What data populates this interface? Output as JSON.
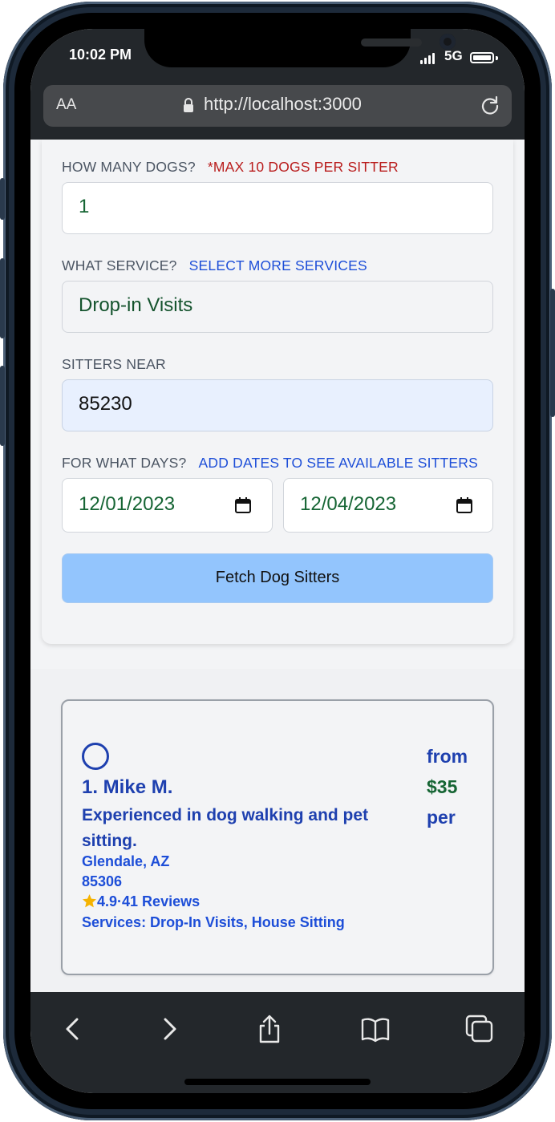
{
  "status_bar": {
    "time": "10:02 PM",
    "network": "5G"
  },
  "browser": {
    "text_size_label": "AA",
    "url": "http://localhost:3000"
  },
  "form": {
    "dogs_label": "HOW MANY DOGS?",
    "dogs_note": "*MAX 10 DOGS PER SITTER",
    "dogs_value": "1",
    "service_label": "WHAT SERVICE?",
    "service_link": "SELECT MORE SERVICES",
    "service_value": "Drop-in Visits",
    "near_label": "SITTERS NEAR",
    "near_value": "85230",
    "days_label": "FOR WHAT DAYS?",
    "days_link": "ADD DATES TO SEE AVAILABLE SITTERS",
    "start_date": "12/01/2023",
    "end_date": "12/04/2023",
    "fetch_button": "Fetch Dog Sitters"
  },
  "results": [
    {
      "name": "1. Mike M.",
      "description": "Experienced in dog walking and pet sitting.",
      "city": "Glendale, AZ",
      "zip": "85306",
      "rating": "4.9",
      "separator": "·",
      "reviews": "41 Reviews",
      "services": "Services: Drop-In Visits, House Sitting",
      "price_from": "from",
      "price": "$35",
      "price_per": "per"
    }
  ],
  "colors": {
    "accent_blue": "#1e40af",
    "link_blue": "#1d4ed8",
    "warning_red": "#b91c1c",
    "value_green": "#166534",
    "button_blue": "#93c5fd",
    "star": "#f5b301"
  },
  "icons": [
    "lock-icon",
    "reload-icon",
    "calendar-icon",
    "star-icon",
    "back-icon",
    "forward-icon",
    "share-icon",
    "bookmarks-icon",
    "tabs-icon"
  ]
}
